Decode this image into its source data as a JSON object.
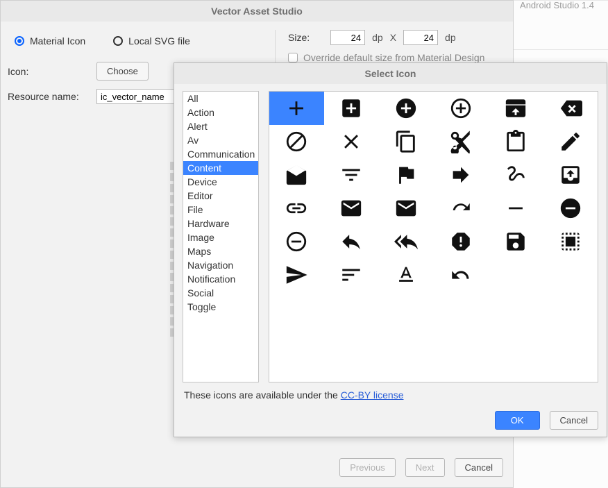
{
  "top_right_label": "Android Studio 1.4",
  "main": {
    "title": "Vector Asset Studio",
    "radio": {
      "material": "Material Icon",
      "svg": "Local SVG file"
    },
    "icon_label": "Icon:",
    "choose_btn": "Choose",
    "resname_label": "Resource name:",
    "resname_value": "ic_vector_name",
    "size_label": "Size:",
    "size_w": "24",
    "size_h": "24",
    "dp": "dp",
    "times": "X",
    "override": "Override default size from Material Design",
    "previous_btn": "Previous",
    "next_btn": "Next",
    "cancel_btn": "Cancel"
  },
  "modal": {
    "title": "Select Icon",
    "categories": [
      "All",
      "Action",
      "Alert",
      "Av",
      "Communication",
      "Content",
      "Device",
      "Editor",
      "File",
      "Hardware",
      "Image",
      "Maps",
      "Navigation",
      "Notification",
      "Social",
      "Toggle"
    ],
    "selected_category": "Content",
    "selected_icon": "add",
    "icons": [
      "add",
      "add-box",
      "add-circle",
      "add-circle-outline",
      "archive",
      "backspace",
      "block",
      "clear",
      "content-copy",
      "content-cut",
      "content-paste",
      "create",
      "drafts",
      "filter-list",
      "flag",
      "forward",
      "gesture",
      "inbox",
      "link",
      "mail",
      "markunread",
      "redo",
      "remove",
      "remove-circle",
      "remove-circle-outline",
      "reply",
      "reply-all",
      "report",
      "save",
      "select-all",
      "send",
      "sort",
      "text-format",
      "undo"
    ],
    "license_prefix": "These icons are available under the ",
    "license_link": "CC-BY license",
    "ok_btn": "OK",
    "cancel_btn": "Cancel"
  }
}
